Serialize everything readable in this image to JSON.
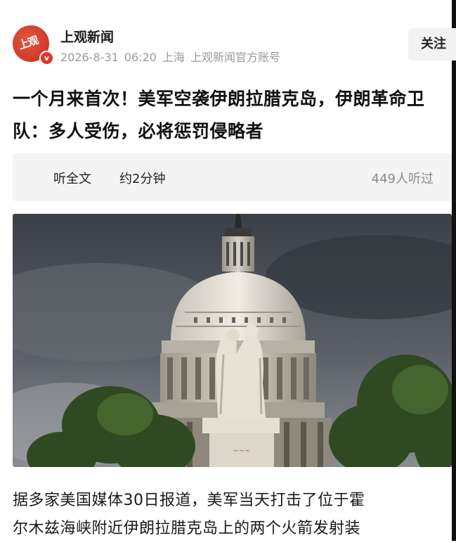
{
  "account": {
    "name": "上观新闻",
    "avatar_text": "上观",
    "verified_icon": "v-badge-icon",
    "date": "2026-8-31",
    "time": "06:20",
    "location": "上海",
    "type": "上观新闻官方账号",
    "follow_label": "关注"
  },
  "article": {
    "title": "一个月来首次！美军空袭伊朗拉腊克岛，伊朗革命卫队：多人受伤，必将惩罚侵略者"
  },
  "audio": {
    "label": "听全文",
    "duration": "约2分钟",
    "listens": "449人听过"
  },
  "content": {
    "line1": "据多家美国媒体30日报道，美军当天打击了位于霍",
    "line2": "尔木兹海峡附近伊朗拉腊克岛上的两个火箭发射装"
  },
  "colors": {
    "brand_red": "#e0362b",
    "meta_gray": "#9a9a9a",
    "bar_bg": "#f4f4f4"
  }
}
